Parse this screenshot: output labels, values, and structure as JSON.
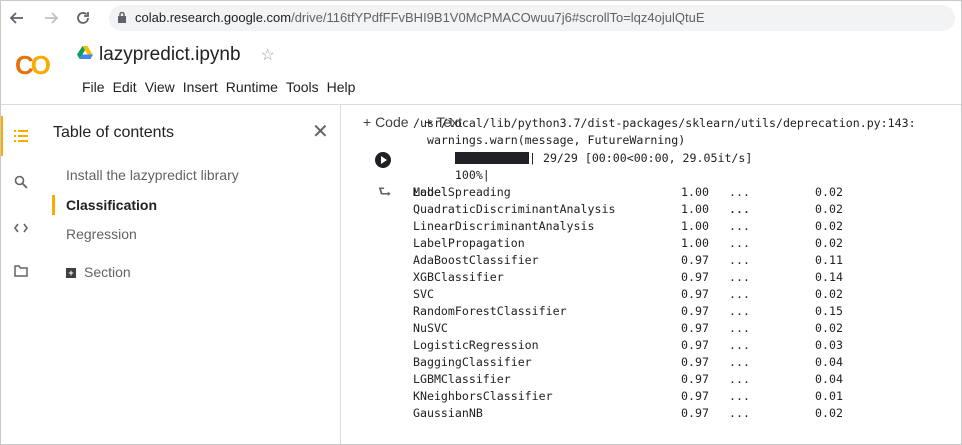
{
  "browser": {
    "url_host": "colab.research.google.com",
    "url_path": "/drive/116tfYPdfFFvBHI9B1V0McPMACOwuu7j6#scrollTo=lqz4ojulQtuE",
    "back_icon": "arrow-left-icon",
    "forward_icon": "arrow-right-icon",
    "reload_icon": "reload-icon",
    "lock_icon": "lock-icon"
  },
  "header": {
    "logo": "CO",
    "notebook_name": "lazypredict.ipynb",
    "menu": [
      "File",
      "Edit",
      "View",
      "Insert",
      "Runtime",
      "Tools",
      "Help"
    ]
  },
  "toc": {
    "title": "Table of contents",
    "items": [
      {
        "label": "Install the lazypredict library"
      },
      {
        "label": "Classification"
      },
      {
        "label": "Regression"
      },
      {
        "label": "Section"
      }
    ]
  },
  "toolbar": {
    "add_code": "+ Code",
    "add_text": "+ Text"
  },
  "output": {
    "lines": [
      "/usr/local/lib/python3.7/dist-packages/sklearn/utils/deprecation.py:143:",
      "  warnings.warn(message, FutureWarning)"
    ],
    "progress_pct": "100%|",
    "progress_fraction": 1.0,
    "progress_rest": "| 29/29 [00:00<00:00, 29.05it/s]",
    "header_model": "Model",
    "header_dots": "...",
    "rows": [
      {
        "model": "LabelSpreading",
        "v1": "1.00",
        "dots": "...",
        "v2": "0.02"
      },
      {
        "model": "QuadraticDiscriminantAnalysis",
        "v1": "1.00",
        "dots": "...",
        "v2": "0.02"
      },
      {
        "model": "LinearDiscriminantAnalysis",
        "v1": "1.00",
        "dots": "...",
        "v2": "0.02"
      },
      {
        "model": "LabelPropagation",
        "v1": "1.00",
        "dots": "...",
        "v2": "0.02"
      },
      {
        "model": "AdaBoostClassifier",
        "v1": "0.97",
        "dots": "...",
        "v2": "0.11"
      },
      {
        "model": "XGBClassifier",
        "v1": "0.97",
        "dots": "...",
        "v2": "0.14"
      },
      {
        "model": "SVC",
        "v1": "0.97",
        "dots": "...",
        "v2": "0.02"
      },
      {
        "model": "RandomForestClassifier",
        "v1": "0.97",
        "dots": "...",
        "v2": "0.15"
      },
      {
        "model": "NuSVC",
        "v1": "0.97",
        "dots": "...",
        "v2": "0.02"
      },
      {
        "model": "LogisticRegression",
        "v1": "0.97",
        "dots": "...",
        "v2": "0.03"
      },
      {
        "model": "BaggingClassifier",
        "v1": "0.97",
        "dots": "...",
        "v2": "0.04"
      },
      {
        "model": "LGBMClassifier",
        "v1": "0.97",
        "dots": "...",
        "v2": "0.04"
      },
      {
        "model": "KNeighborsClassifier",
        "v1": "0.97",
        "dots": "...",
        "v2": "0.01"
      },
      {
        "model": "GaussianNB",
        "v1": "0.97",
        "dots": "...",
        "v2": "0.02"
      }
    ]
  },
  "colors": {
    "accent": "#f9ab00",
    "logo_orange": "#e8710a"
  }
}
